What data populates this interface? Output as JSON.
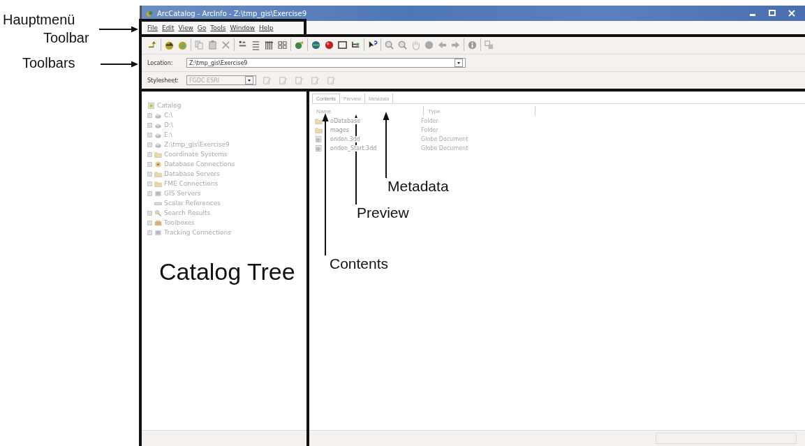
{
  "window": {
    "title": "ArcCatalog - ArcInfo - Z:\\tmp_gis\\Exercise9"
  },
  "menu": [
    "File",
    "Edit",
    "View",
    "Go",
    "Tools",
    "Window",
    "Help"
  ],
  "location": {
    "label": "Location:",
    "value": "Z:\\tmp_gis\\Exercise9"
  },
  "stylesheet": {
    "label": "Stylesheet:",
    "value": "FGDC ESRI"
  },
  "tree": {
    "label": "Catalog",
    "children": [
      {
        "label": "C:\\",
        "kind": "drive",
        "expander": true
      },
      {
        "label": "D:\\",
        "kind": "drive",
        "expander": true
      },
      {
        "label": "E:\\",
        "kind": "drive",
        "expander": true
      },
      {
        "label": "Z:\\tmp_gis\\Exercise9",
        "kind": "drive",
        "expander": true
      },
      {
        "label": "Coordinate Systems",
        "kind": "folder",
        "expander": true
      },
      {
        "label": "Database Connections",
        "kind": "database",
        "expander": true
      },
      {
        "label": "Database Servers",
        "kind": "folder",
        "expander": true
      },
      {
        "label": "FME Connections",
        "kind": "folder",
        "expander": true
      },
      {
        "label": "GIS Servers",
        "kind": "server",
        "expander": true
      },
      {
        "label": "Scalar References",
        "kind": "ruler",
        "expander": false
      },
      {
        "label": "Search Results",
        "kind": "search",
        "expander": true
      },
      {
        "label": "Toolboxes",
        "kind": "toolbox",
        "expander": true
      },
      {
        "label": "Tracking Connections",
        "kind": "server",
        "expander": true
      }
    ]
  },
  "tabs": [
    {
      "label": "Contents",
      "selected": true
    },
    {
      "label": "Preview",
      "selected": false
    },
    {
      "label": "Metadata",
      "selected": false
    }
  ],
  "table": {
    "columns": [
      "Name",
      "Type"
    ],
    "rows": [
      {
        "kind": "folder",
        "name": "oDatabase",
        "type": "Folder"
      },
      {
        "kind": "folder",
        "name": "mages",
        "type": "Folder"
      },
      {
        "kind": "globe",
        "name": "ondon.3dd",
        "type": "Globe Document"
      },
      {
        "kind": "globe",
        "name": "ondon_Start.3dd",
        "type": "Globe Document"
      }
    ]
  },
  "annotations": [
    "Hauptmenü",
    "Toolbar",
    "Toolbars",
    "Catalog Tree",
    "Contents",
    "Preview",
    "Metadata"
  ]
}
